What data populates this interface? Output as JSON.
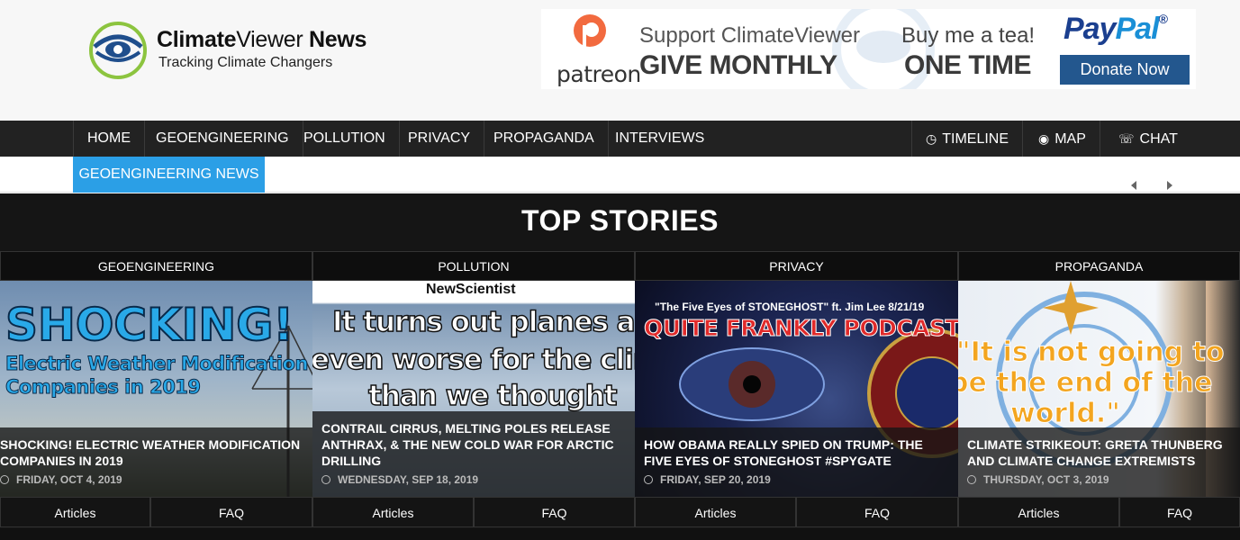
{
  "brand": {
    "title_bold": "Climate",
    "title_thin": "Viewer",
    "title_bold2": " News",
    "tagline": "Tracking Climate Changers",
    "logo_icon": "eye-logo-icon"
  },
  "banner": {
    "patreon_word": "patreon",
    "support": "Support ClimateViewer",
    "give": "GIVE MONTHLY",
    "tea": "Buy me a  tea!",
    "onetime": "ONE TIME",
    "paypal_a": "Pay",
    "paypal_b": "Pal",
    "paypal_tm": "®",
    "donate": "Donate Now"
  },
  "nav": {
    "items": [
      "HOME",
      "GEOENGINEERING",
      "POLLUTION",
      "PRIVACY",
      "PROPAGANDA",
      "INTERVIEWS"
    ],
    "right_items": [
      {
        "label": "TIMELINE",
        "icon": "clock-icon"
      },
      {
        "label": "MAP",
        "icon": "globe-icon"
      },
      {
        "label": "CHAT",
        "icon": "chat-icon"
      }
    ],
    "sub_active": "GEOENGINEERING NEWS"
  },
  "top_stories": {
    "heading": "TOP STORIES",
    "columns": [
      {
        "category": "GEOENGINEERING",
        "thumb_lines": [
          "SHOCKING!",
          "Electric Weather Modification",
          "Companies in 2019"
        ],
        "title": "SHOCKING! ELECTRIC WEATHER MODIFICATION COMPANIES IN 2019",
        "date": "FRIDAY, OCT 4, 2019",
        "tabs": [
          "Articles",
          "FAQ"
        ]
      },
      {
        "category": "POLLUTION",
        "thumb_lines": [
          "NewScientist",
          "It turns out planes are",
          "even worse for the climate",
          "than we thought"
        ],
        "title": "CONTRAIL CIRRUS, MELTING POLES RELEASE ANTHRAX, & THE NEW COLD WAR FOR ARCTIC DRILLING",
        "date": "WEDNESDAY, SEP 18, 2019",
        "tabs": [
          "Articles",
          "FAQ"
        ]
      },
      {
        "category": "PRIVACY",
        "thumb_lines": [
          "\"The Five Eyes of STONEGHOST\" ft. Jim Lee 8/21/19",
          "QUITE FRANKLY PODCAST"
        ],
        "title": "HOW OBAMA REALLY SPIED ON TRUMP: THE FIVE EYES OF STONEGHOST #SPYGATE",
        "date": "FRIDAY, SEP 20, 2019",
        "tabs": [
          "Articles",
          "FAQ"
        ]
      },
      {
        "category": "PROPAGANDA",
        "thumb_lines": [
          "\"It is not going to",
          "be the end of the",
          "world.\""
        ],
        "title": "CLIMATE STRIKEOUT: GRETA THUNBERG AND CLIMATE CHANGE EXTREMISTS",
        "date": "THURSDAY, OCT 3, 2019",
        "tabs": [
          "Articles",
          "FAQ"
        ]
      }
    ]
  },
  "colors": {
    "nav_bg": "#222222",
    "accent": "#2b9fe6",
    "stories_bg": "#151515",
    "donate_bg": "#23578e"
  }
}
